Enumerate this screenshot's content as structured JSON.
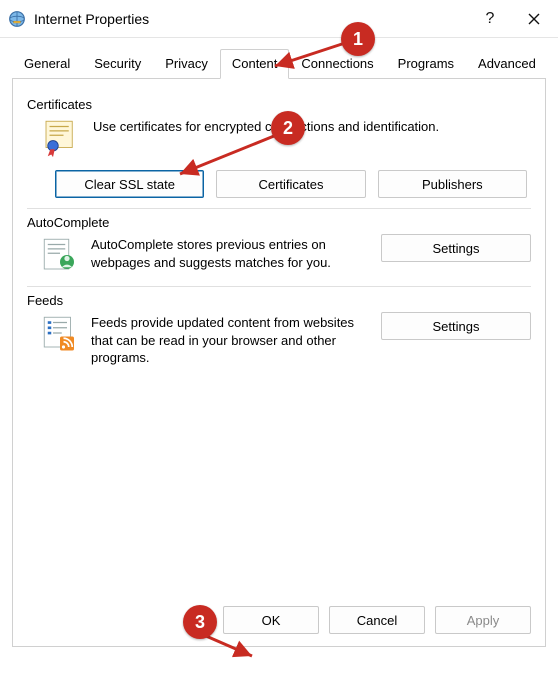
{
  "window": {
    "title": "Internet Properties"
  },
  "tabs": [
    {
      "label": "General"
    },
    {
      "label": "Security"
    },
    {
      "label": "Privacy"
    },
    {
      "label": "Content"
    },
    {
      "label": "Connections"
    },
    {
      "label": "Programs"
    },
    {
      "label": "Advanced"
    }
  ],
  "certificates": {
    "heading": "Certificates",
    "description": "Use certificates for encrypted connections and identification.",
    "clear_ssl_label": "Clear SSL state",
    "certificates_label": "Certificates",
    "publishers_label": "Publishers"
  },
  "autocomplete": {
    "heading": "AutoComplete",
    "description": "AutoComplete stores previous entries on webpages and suggests matches for you.",
    "settings_label": "Settings"
  },
  "feeds": {
    "heading": "Feeds",
    "description": "Feeds provide updated content from websites that can be read in your browser and other programs.",
    "settings_label": "Settings"
  },
  "buttons": {
    "ok": "OK",
    "cancel": "Cancel",
    "apply": "Apply"
  },
  "annotations": {
    "step1": "1",
    "step2": "2",
    "step3": "3"
  }
}
